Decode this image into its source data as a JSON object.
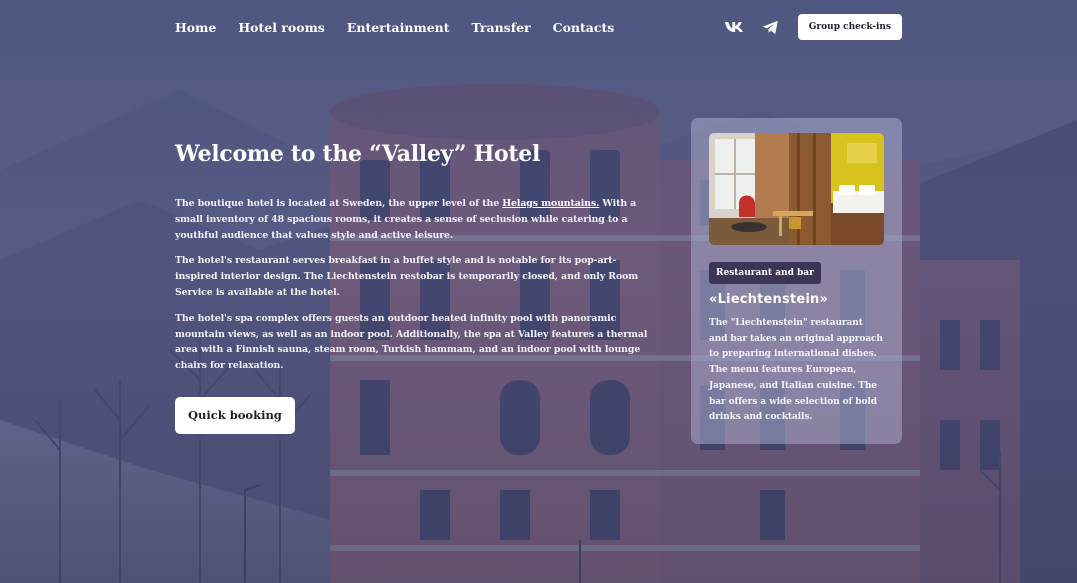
{
  "nav": {
    "items": [
      {
        "label": "Home"
      },
      {
        "label": "Hotel rooms"
      },
      {
        "label": "Entertainment"
      },
      {
        "label": "Transfer"
      },
      {
        "label": "Contacts"
      }
    ],
    "social_icons": [
      "vk-icon",
      "telegram-icon"
    ],
    "group_button": "Group check-ins"
  },
  "hero": {
    "title": "Welcome to the “Valley” Hotel",
    "p1_before": "The boutique hotel is located at Sweden, the upper level of the ",
    "p1_link": "Helags mountains.",
    "p1_after": " With a small inventory of 48 spacious rooms, it creates a sense of seclusion while catering to a youthful audience that values style and active leisure.",
    "p2": "The hotel's restaurant serves breakfast in a buffet style and is notable for its pop-art-inspired interior design. The Liechtenstein restobar is temporarily closed, and only Room Service is available at the hotel.",
    "p3": "The hotel's spa complex offers guests an outdoor heated infinity pool with panoramic mountain views, as well as an indoor pool. Additionally, the spa at Valley features a thermal area with a Finnish sauna, steam room, Turkish hammam, and an indoor pool with lounge chairs for relaxation.",
    "cta": "Quick booking"
  },
  "card": {
    "tag": "Restaurant and bar",
    "title": "«Liechtenstein»",
    "text": "The \"Liechtenstein\" restaurant and bar takes an original approach to preparing international dishes. The menu features European, Japanese, and Italian cuisine. The bar offers a wide selection of bold drinks and cocktails."
  },
  "colors": {
    "overlay": "#464a78",
    "card_tag_bg": "#3d3556",
    "button_bg": "#ffffff"
  }
}
